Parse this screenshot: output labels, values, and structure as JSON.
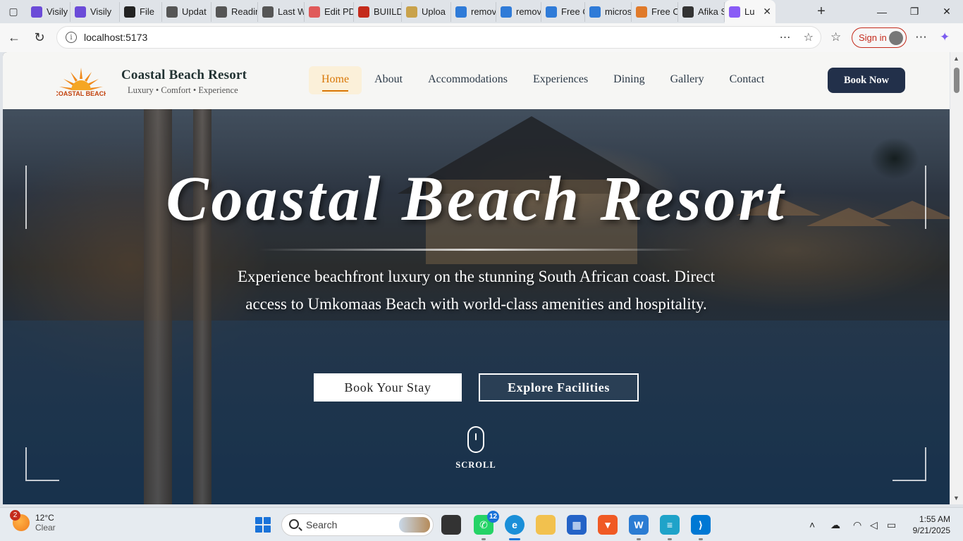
{
  "browser": {
    "tabs": [
      {
        "label": "Visily",
        "icon": "visily-icon",
        "color": "#6b4bd8"
      },
      {
        "label": "Visily",
        "icon": "visily-icon",
        "color": "#6b4bd8"
      },
      {
        "label": "File",
        "icon": "play-icon",
        "color": "#222222"
      },
      {
        "label": "Updat",
        "icon": "openai-icon",
        "color": "#555555"
      },
      {
        "label": "Readin",
        "icon": "reading-icon",
        "color": "#555555"
      },
      {
        "label": "Last W",
        "icon": "document-icon",
        "color": "#555555"
      },
      {
        "label": "Edit PD",
        "icon": "heart-icon",
        "color": "#e05a5a"
      },
      {
        "label": "BUIILD",
        "icon": "pdf-icon",
        "color": "#c42b1c"
      },
      {
        "label": "Uploa",
        "icon": "upload-icon",
        "color": "#c9a24a"
      },
      {
        "label": "remov",
        "icon": "bing-icon",
        "color": "#2f7bd8"
      },
      {
        "label": "remov",
        "icon": "bing-icon",
        "color": "#2f7bd8"
      },
      {
        "label": "Free O",
        "icon": "pen-icon",
        "color": "#2f7bd8"
      },
      {
        "label": "micros",
        "icon": "search-icon",
        "color": "#2f7bd8"
      },
      {
        "label": "Free O",
        "icon": "microsoft-icon",
        "color": "#e07a2a"
      },
      {
        "label": "Afika S",
        "icon": "globe-icon",
        "color": "#333333"
      },
      {
        "label": "Lu",
        "icon": "vite-icon",
        "color": "#8a5cf6"
      }
    ],
    "url": "localhost:5173",
    "signin_label": "Sign in"
  },
  "site": {
    "brand_name": "Coastal Beach Resort",
    "brand_tagline": "Luxury • Comfort • Experience",
    "logo_text": "COASTAL BEACH",
    "nav": [
      "Home",
      "About",
      "Accommodations",
      "Experiences",
      "Dining",
      "Gallery",
      "Contact"
    ],
    "active_nav": "Home",
    "book_now_label": "Book Now",
    "accent_color": "#d97706",
    "primary_color": "#22304a"
  },
  "hero": {
    "title": "Coastal Beach Resort",
    "subtitle": "Experience beachfront luxury on the stunning South African coast. Direct access to Umkomaas Beach with world-class amenities and hospitality.",
    "primary_cta": "Book Your Stay",
    "secondary_cta": "Explore Facilities",
    "scroll_label": "SCROLL"
  },
  "taskbar": {
    "weather_badge": "2",
    "temperature": "12°C",
    "condition": "Clear",
    "search_placeholder": "Search",
    "whatsapp_badge": "12",
    "time": "1:55 AM",
    "date": "9/21/2025"
  }
}
